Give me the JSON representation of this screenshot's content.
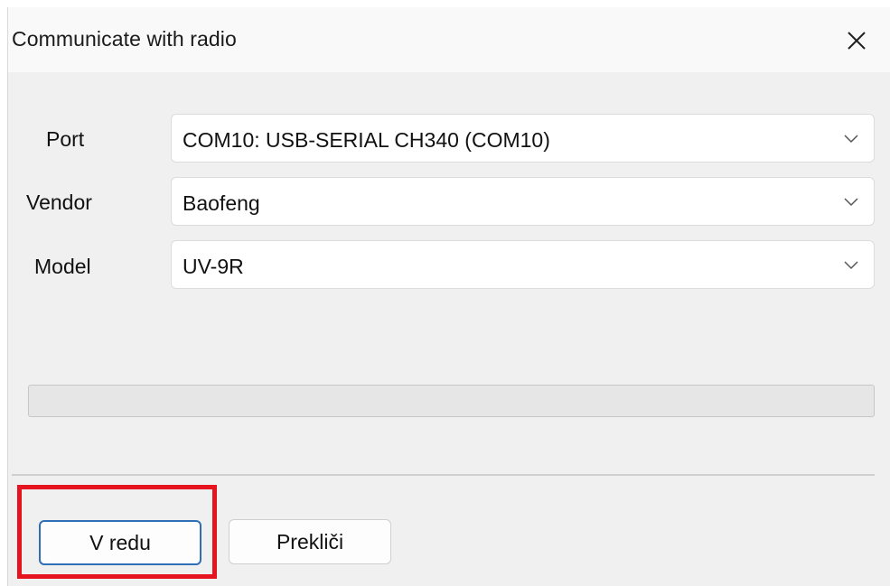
{
  "dialog": {
    "title": "Communicate with radio",
    "close_icon": "close-icon"
  },
  "fields": {
    "port": {
      "label": "Port",
      "value": "COM10: USB-SERIAL CH340 (COM10)"
    },
    "vendor": {
      "label": "Vendor",
      "value": "Baofeng"
    },
    "model": {
      "label": "Model",
      "value": "UV-9R"
    }
  },
  "progress": {
    "value": 0
  },
  "buttons": {
    "ok_label": "V redu",
    "cancel_label": "Prekliči"
  },
  "annotation": {
    "highlight_color": "#e5141e"
  },
  "colors": {
    "accent": "#2f6fb5"
  }
}
